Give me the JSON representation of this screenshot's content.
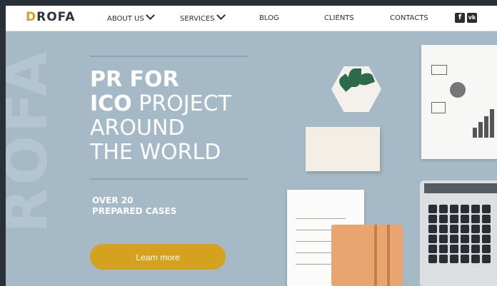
{
  "nav": {
    "logo_accent": "D",
    "logo_rest": "ROFA",
    "items": [
      {
        "label": "ABOUT US",
        "dropdown": true
      },
      {
        "label": "SERVICES",
        "dropdown": true
      },
      {
        "label": "BLOG",
        "dropdown": false
      },
      {
        "label": "CLIENTS",
        "dropdown": false
      },
      {
        "label": "CONTACTS",
        "dropdown": false
      }
    ],
    "social": [
      {
        "icon": "facebook-icon",
        "glyph": "f"
      },
      {
        "icon": "vk-icon",
        "glyph": "vk"
      }
    ]
  },
  "hero": {
    "watermark": "ROFA",
    "headline": {
      "line1": "PR FOR",
      "line2_bold": "ICO",
      "line2_rest": " PROJECT",
      "line3": "AROUND",
      "line4": "THE WORLD"
    },
    "stats_line1": "OVER 20",
    "stats_line2": "PREPARED CASES",
    "cta_label": "Learn more"
  },
  "colors": {
    "accent": "#d4a21f",
    "hero_bg": "#a5b9c6",
    "nav_bg": "#ffffff"
  }
}
